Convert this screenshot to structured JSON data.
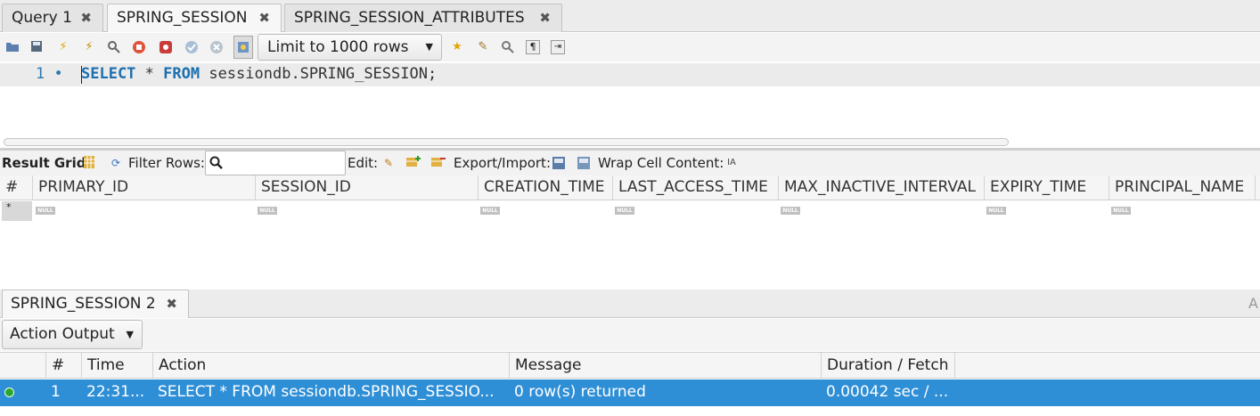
{
  "query_tabs": [
    {
      "label": "Query 1",
      "close": "✖"
    },
    {
      "label": "SPRING_SESSION",
      "close": "✖"
    },
    {
      "label": "SPRING_SESSION_ATTRIBUTES",
      "close": "✖"
    }
  ],
  "toolbar": {
    "icons": [
      "open-folder-icon",
      "save-icon",
      "execute-icon",
      "execute-current-icon",
      "explain-icon",
      "stop-icon",
      "toggle-error-icon",
      "commit-icon",
      "rollback-icon",
      "autocommit-icon"
    ],
    "limit_select": "Limit to 1000 rows",
    "right_icons": [
      "bookmark-icon",
      "beautify-icon",
      "find-icon",
      "invisible-chars-icon",
      "wrap-icon"
    ]
  },
  "editor": {
    "line_number": "1",
    "line_marker": "•",
    "kw_select": "SELECT",
    "op_star": " * ",
    "kw_from": "FROM",
    "table_ref": " sessiondb.SPRING_SESSION;"
  },
  "result_toolbar": {
    "result_grid": "Result Grid",
    "filter_rows": "Filter Rows:",
    "filter_value": "",
    "edit": "Edit:",
    "export_import": "Export/Import:",
    "wrap_cell": "Wrap Cell Content:"
  },
  "grid": {
    "row_header": "#",
    "columns": [
      "PRIMARY_ID",
      "SESSION_ID",
      "CREATION_TIME",
      "LAST_ACCESS_TIME",
      "MAX_INACTIVE_INTERVAL",
      "EXPIRY_TIME",
      "PRINCIPAL_NAME"
    ],
    "new_row_marker": "*",
    "null_label": "NULL"
  },
  "output_tabs": {
    "active": "SPRING_SESSION 2",
    "close": "✖",
    "right_label": "A"
  },
  "action_output": {
    "selector": "Action Output",
    "columns": [
      "",
      "#",
      "Time",
      "Action",
      "Message",
      "Duration / Fetch"
    ],
    "rows": [
      {
        "num": "1",
        "time": "22:31...",
        "action": "SELECT * FROM sessiondb.SPRING_SESSIO...",
        "message": "0 row(s) returned",
        "duration": "0.00042 sec / ..."
      }
    ]
  },
  "colors": {
    "accent": "#2f8fd6",
    "keyword": "#1b6fb0",
    "ok": "#2ba72b"
  }
}
